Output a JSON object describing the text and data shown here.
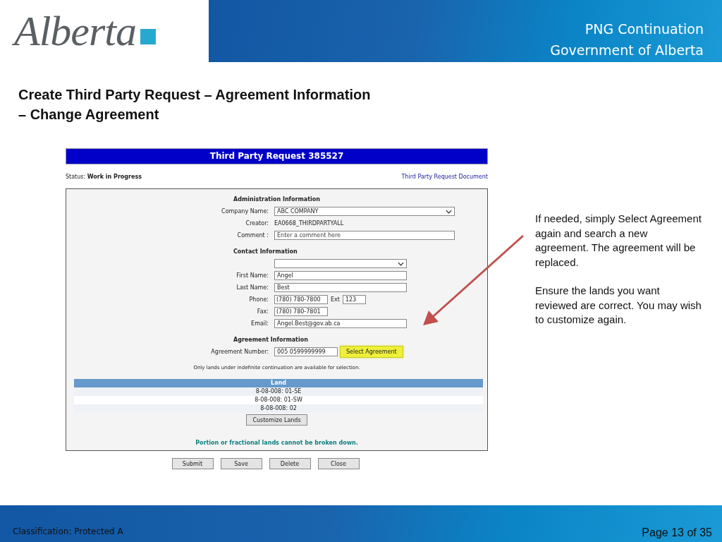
{
  "header": {
    "logo_text": "Alberta",
    "title": "PNG Continuation",
    "subtitle": "Government of Alberta"
  },
  "slide_title": [
    "Create Third Party Request – Agreement Information",
    "– Change Agreement"
  ],
  "form": {
    "title": "Third Party Request 385527",
    "status_label": "Status:",
    "status_value": "Work in Progress",
    "document_link": "Third Party Request Document",
    "sections": [
      {
        "heading": "Administration Information",
        "fields": [
          {
            "kind": "select",
            "label": "Company Name:",
            "value": "ABC COMPANY"
          },
          {
            "kind": "text",
            "label": "Creator:",
            "value": "EA0668_THIRDPARTYALL"
          },
          {
            "kind": "input",
            "label": "Comment :",
            "placeholder": "Enter a comment here"
          }
        ]
      },
      {
        "heading": "Contact Information",
        "fields": [
          {
            "kind": "select"
          },
          {
            "kind": "input",
            "label": "First Name:",
            "value": "Angel"
          },
          {
            "kind": "input",
            "label": "Last Name:",
            "value": "Best"
          },
          {
            "kind": "phone",
            "label": "Phone:",
            "value": "(780) 780-7800",
            "ext_label": "Ext",
            "ext_value": "123"
          },
          {
            "kind": "input",
            "label": "Fax:",
            "value": "(780) 780-7801"
          },
          {
            "kind": "input",
            "label": "Email:",
            "value": "Angel.Best@gov.ab.ca"
          }
        ]
      },
      {
        "heading": "Agreement Information",
        "fields": [
          {
            "kind": "agreement",
            "label": "Agreement Number:",
            "value": "005 0599999999",
            "button": "Select Agreement",
            "highlighted": true
          }
        ]
      }
    ],
    "availability_note": "Only lands under indefinite continuation are available for selection.",
    "land_table": {
      "column": "Land",
      "rows": [
        "8-08-008: 01-SE",
        "8-08-008: 01-SW",
        "8-08-008: 02"
      ]
    },
    "customize_button": "Customize Lands",
    "warning": "Portion or fractional lands cannot be broken down.",
    "buttons": [
      "Submit",
      "Save",
      "Delete",
      "Close"
    ]
  },
  "note": [
    "If needed, simply Select Agreement again and search a new agreement.  The agreement will be replaced.",
    "Ensure the lands you want reviewed are correct.  You may wish to customize again."
  ],
  "footer": {
    "classification": "Classification: Protected A",
    "page": "Page 13 of 35"
  }
}
